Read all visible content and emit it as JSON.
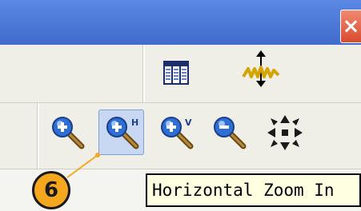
{
  "window": {
    "close_label": "×"
  },
  "toolbar_top": {
    "items": [
      {
        "icon": "table-icon"
      },
      {
        "icon": "waveform-cursor-icon"
      }
    ]
  },
  "toolbar_zoom": {
    "items": [
      {
        "icon": "zoom-in-icon"
      },
      {
        "icon": "horizontal-zoom-in-icon",
        "badge": "H",
        "state": "pressed"
      },
      {
        "icon": "vertical-zoom-in-icon",
        "badge": "V"
      },
      {
        "icon": "zoom-out-icon"
      },
      {
        "icon": "zoom-fit-icon"
      }
    ]
  },
  "callout": {
    "number": "6"
  },
  "tooltip": {
    "text": "Horizontal Zoom In"
  },
  "colors": {
    "accent": "#4a78d6",
    "callout": "#f5a81e",
    "tooltip_bg": "#ffffe1"
  }
}
